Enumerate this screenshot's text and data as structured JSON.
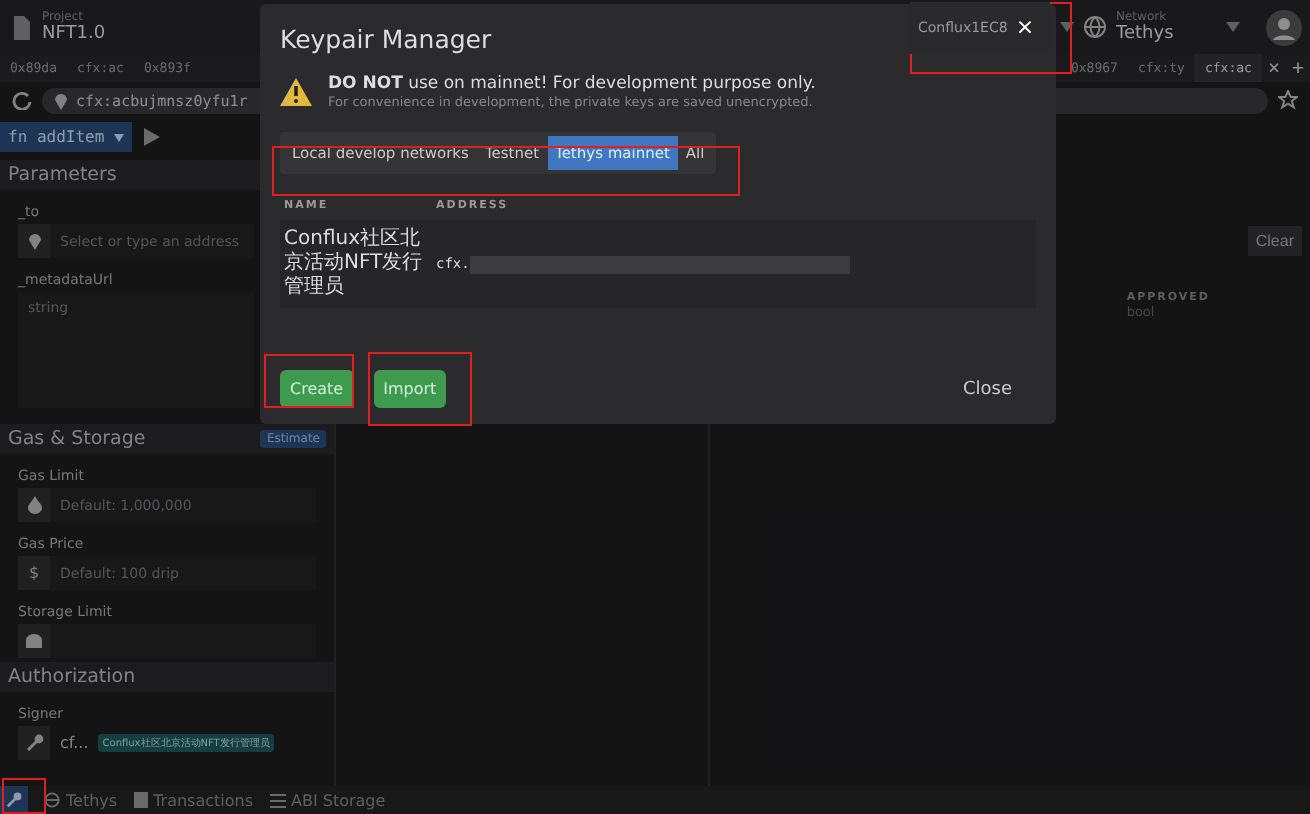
{
  "header": {
    "project_label": "Project",
    "project_name": "NFT1.0",
    "keypair_value": "Conflux1EC8",
    "keypair_clear": "×",
    "network_label": "Network",
    "network_value": "Tethys"
  },
  "tabs_left": [
    {
      "label": "0x89da",
      "selected": false
    },
    {
      "label": "cfx:ac",
      "selected": false
    },
    {
      "label": "0x893f",
      "selected": false
    }
  ],
  "tabs_right": [
    {
      "label": "0x8967",
      "selected": false
    },
    {
      "label": "cfx:ty",
      "selected": false
    },
    {
      "label": "cfx:ac",
      "selected": true
    }
  ],
  "tab_close": "×",
  "add_tab": "+",
  "address_bar": {
    "value": "cfx:acbujmnsz0yfu1r"
  },
  "left_panel": {
    "function_button": "fn addItem",
    "parameters_title": "Parameters",
    "params": [
      {
        "label": "_to",
        "kind": "address",
        "placeholder": "Select or type an address"
      },
      {
        "label": "_metadataUrl",
        "kind": "text",
        "placeholder": "string"
      }
    ],
    "gas_title": "Gas & Storage",
    "estimate_button": "Estimate",
    "gas_fields": [
      {
        "label": "Gas Limit",
        "kind": "gas",
        "placeholder": "Default: 1,000,000"
      },
      {
        "label": "Gas Price",
        "kind": "price",
        "icon": "$",
        "placeholder": "Default: 100 drip"
      },
      {
        "label": "Storage Limit",
        "kind": "storage"
      }
    ],
    "auth_title": "Authorization",
    "signer_label": "Signer",
    "signer_value": "cf...",
    "signer_tag": "Conflux社区北京活动NFT发行管理员"
  },
  "right_panel": {
    "clear_button": "Clear",
    "columns": [
      {
        "name": "APPROVED",
        "type": "bool"
      }
    ]
  },
  "status_bar": [
    {
      "kind": "keypair"
    },
    {
      "kind": "network",
      "label": "Tethys"
    },
    {
      "kind": "transactions",
      "label": "Transactions"
    },
    {
      "kind": "abi",
      "label": "ABI Storage"
    }
  ],
  "dialog": {
    "title": "Keypair Manager",
    "warning": "**DO NOT** use on mainnet! For development purpose only.",
    "note": "For convenience in development, the private keys are saved unencrypted.",
    "filters": [
      {
        "label": "Local develop networks",
        "selected": false
      },
      {
        "label": "Testnet",
        "selected": false
      },
      {
        "label": "Tethys mainnet",
        "selected": true
      },
      {
        "label": "All",
        "selected": false
      }
    ],
    "columns": [
      "NAME",
      "ADDRESS"
    ],
    "keypairs": [
      {
        "name": "Conflux社区北京活动NFT发行管理员",
        "address": "cfx."
      }
    ],
    "create_button": "Create",
    "import_button": "Import",
    "close_button": "Close"
  }
}
